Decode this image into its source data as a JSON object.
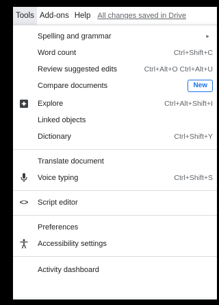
{
  "menubar": {
    "tools": "Tools",
    "addons": "Add-ons",
    "help": "Help",
    "saved_status": "All changes saved in Drive"
  },
  "menu": {
    "spelling": {
      "label": "Spelling and grammar",
      "icon": "submenu-arrow-icon",
      "arrow": "►"
    },
    "word_count": {
      "label": "Word count",
      "shortcut": "Ctrl+Shift+C"
    },
    "review": {
      "label": "Review suggested edits",
      "shortcut": "Ctrl+Alt+O Ctrl+Alt+U"
    },
    "compare": {
      "label": "Compare documents",
      "badge": "New"
    },
    "explore": {
      "label": "Explore",
      "shortcut": "Ctrl+Alt+Shift+I",
      "icon": "explore-icon"
    },
    "linked": {
      "label": "Linked objects"
    },
    "dictionary": {
      "label": "Dictionary",
      "shortcut": "Ctrl+Shift+Y"
    },
    "translate": {
      "label": "Translate document"
    },
    "voice": {
      "label": "Voice typing",
      "shortcut": "Ctrl+Shift+S",
      "icon": "microphone-icon"
    },
    "script": {
      "label": "Script editor",
      "icon": "code-icon"
    },
    "preferences": {
      "label": "Preferences"
    },
    "accessibility": {
      "label": "Accessibility settings",
      "icon": "accessibility-icon"
    },
    "activity": {
      "label": "Activity dashboard"
    }
  },
  "colors": {
    "accent": "#1a73e8",
    "text": "#202124",
    "muted": "#5f6368",
    "divider": "#dadce0"
  }
}
